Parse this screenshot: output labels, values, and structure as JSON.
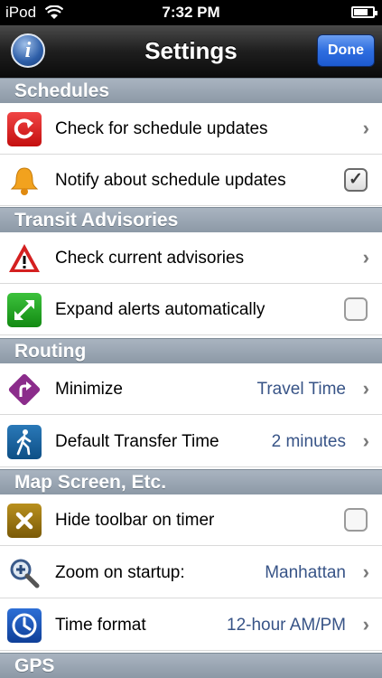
{
  "statusbar": {
    "carrier": "iPod",
    "time": "7:32 PM"
  },
  "navbar": {
    "title": "Settings",
    "info_label": "i",
    "done_label": "Done"
  },
  "sections": [
    {
      "title": "Schedules",
      "rows": [
        {
          "label": "Check for schedule updates",
          "accessory": "chevron",
          "icon": "refresh-icon"
        },
        {
          "label": "Notify about schedule updates",
          "accessory": "checkbox",
          "checked": true,
          "icon": "bell-icon"
        }
      ]
    },
    {
      "title": "Transit Advisories",
      "rows": [
        {
          "label": "Check current advisories",
          "accessory": "chevron",
          "icon": "warning-icon"
        },
        {
          "label": "Expand alerts automatically",
          "accessory": "checkbox",
          "checked": false,
          "icon": "expand-icon"
        }
      ]
    },
    {
      "title": "Routing",
      "rows": [
        {
          "label": "Minimize",
          "value": "Travel Time",
          "accessory": "chevron",
          "icon": "turn-sign-icon"
        },
        {
          "label": "Default Transfer Time",
          "value": "2 minutes",
          "accessory": "chevron",
          "icon": "walking-person-icon"
        }
      ]
    },
    {
      "title": "Map Screen, Etc.",
      "rows": [
        {
          "label": "Hide toolbar on timer",
          "accessory": "checkbox",
          "checked": false,
          "icon": "close-x-icon"
        },
        {
          "label": "Zoom on startup:",
          "value": "Manhattan",
          "accessory": "chevron",
          "icon": "zoom-in-icon"
        },
        {
          "label": "Time format",
          "value": "12-hour AM/PM",
          "accessory": "chevron",
          "icon": "clock-icon"
        }
      ]
    },
    {
      "title": "GPS",
      "rows": []
    }
  ],
  "colors": {
    "section_bg": "#97a3af",
    "value_text": "#385487",
    "done_button": "#2f6ee0"
  }
}
